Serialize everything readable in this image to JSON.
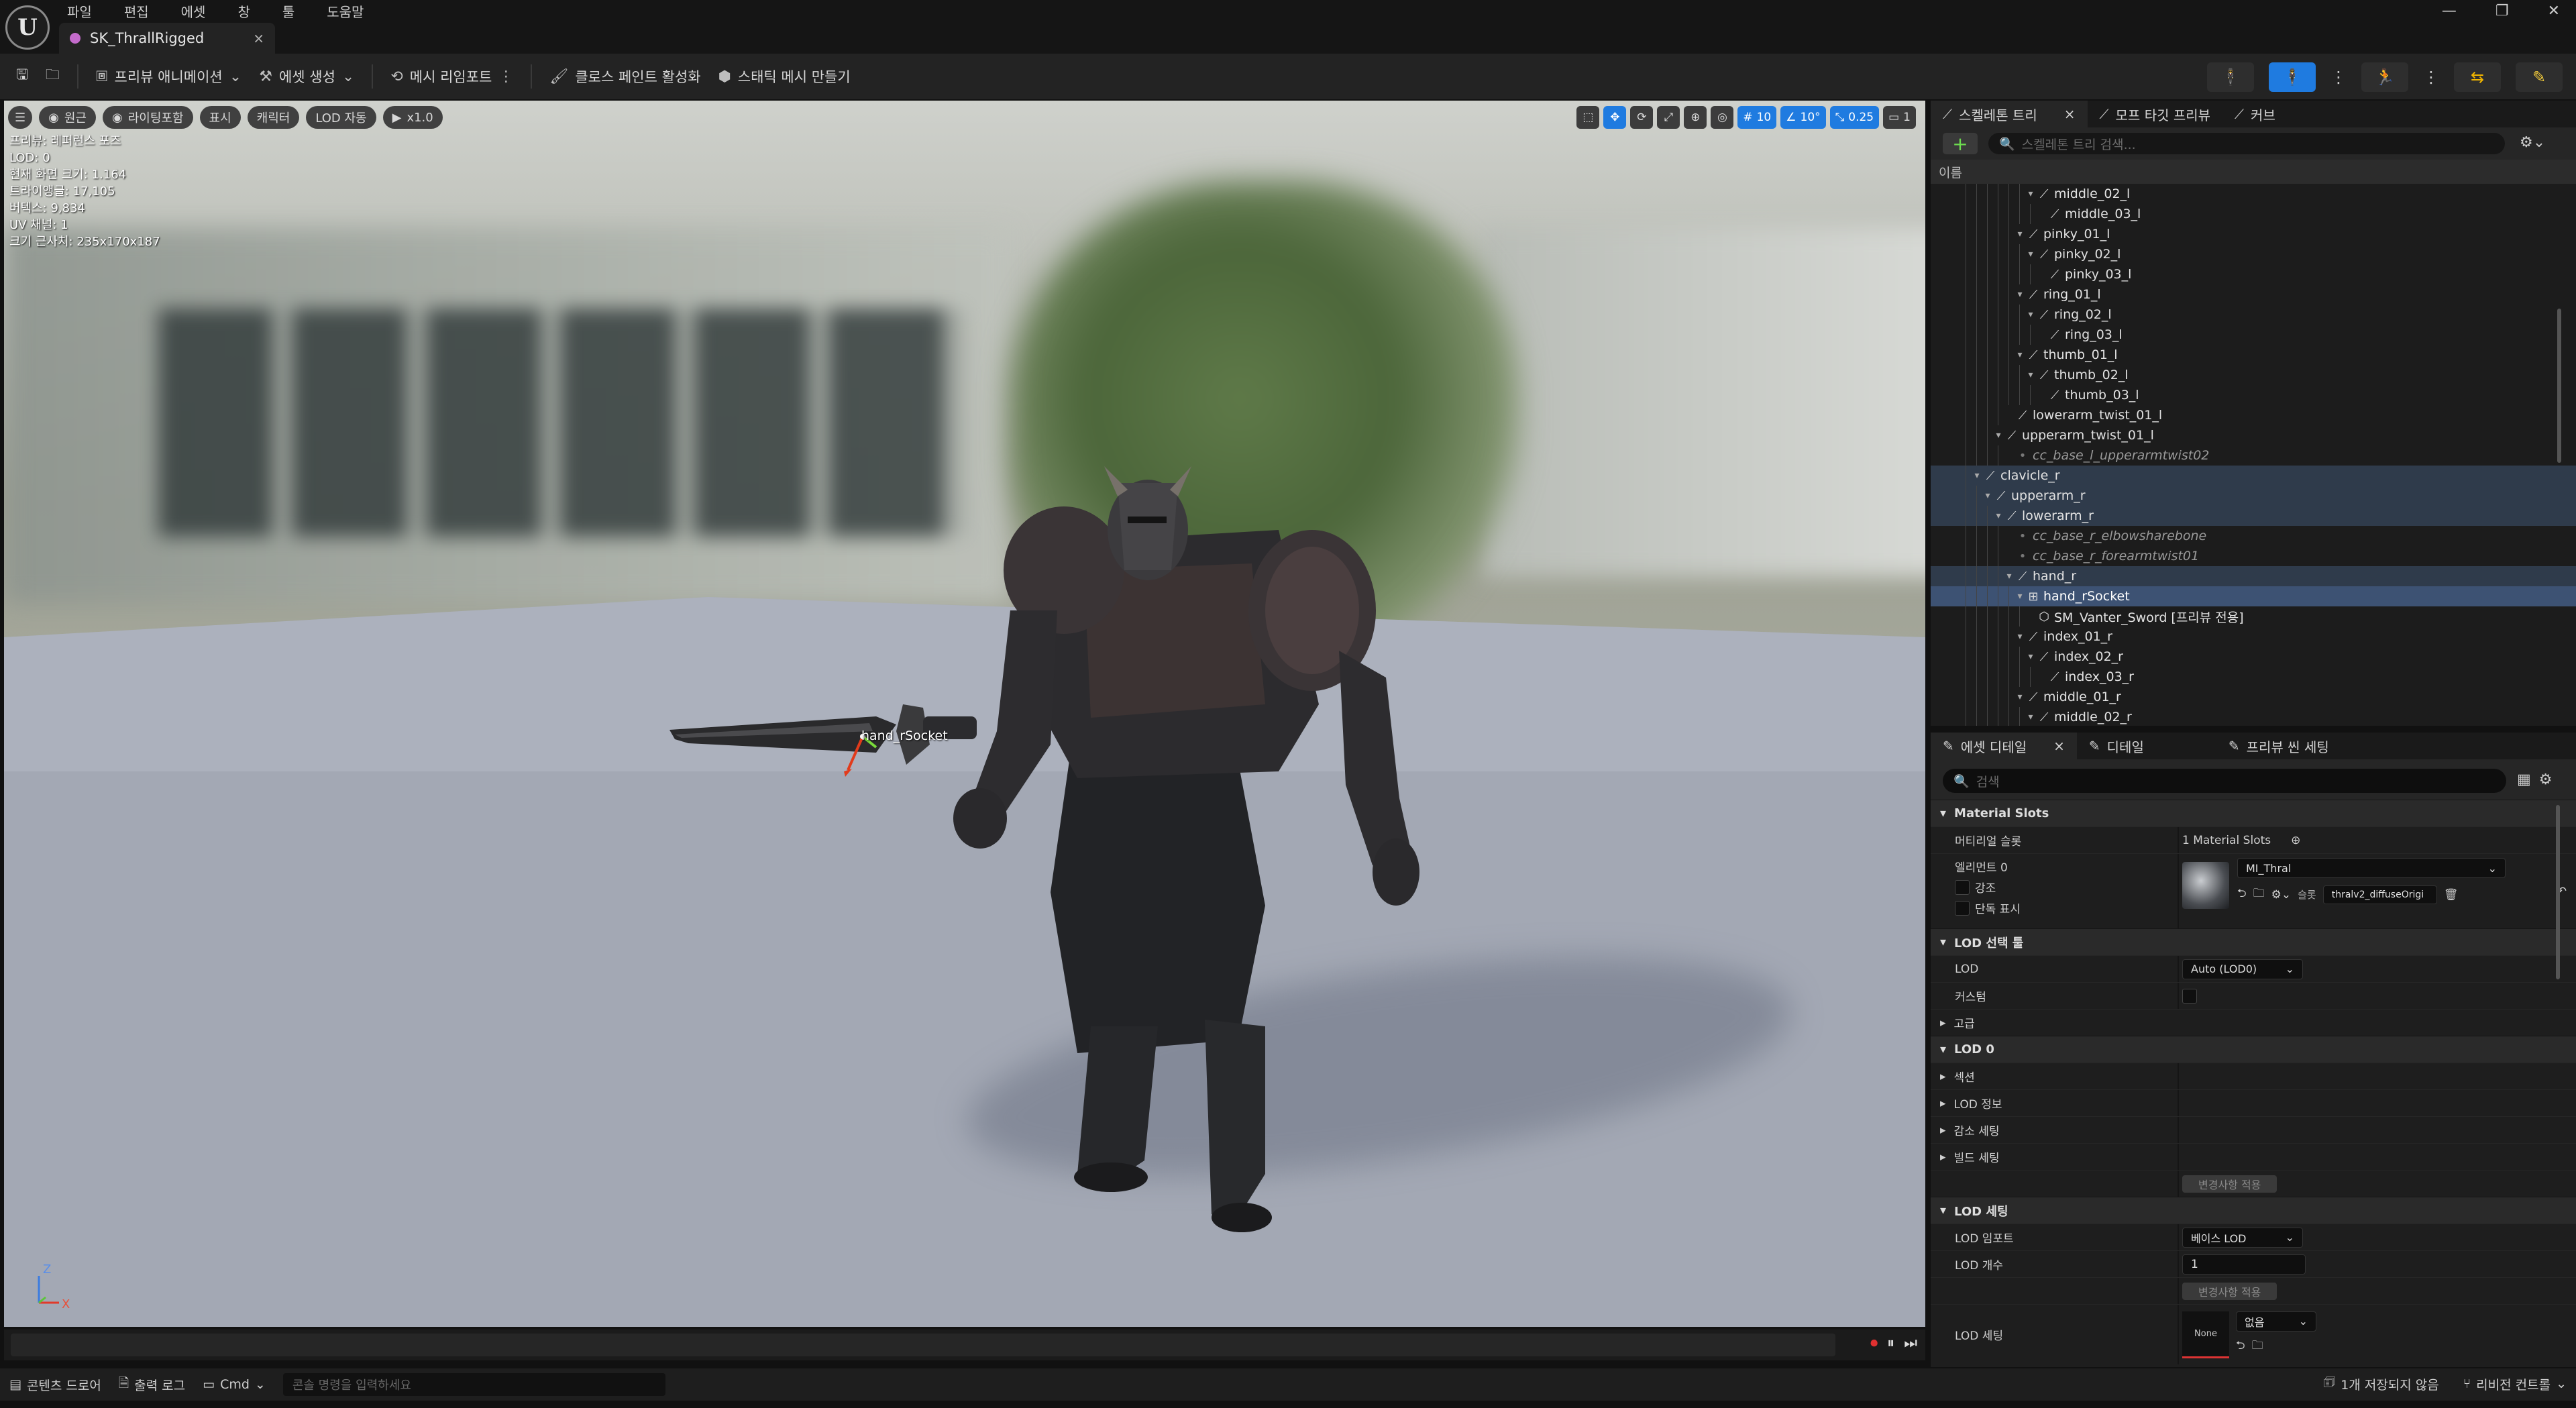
{
  "app": {
    "logo": "U",
    "tab_title": "SK_ThrallRigged",
    "tab_close": "×"
  },
  "menu": [
    "파일",
    "편집",
    "에셋",
    "창",
    "툴",
    "도움말"
  ],
  "window_controls": [
    "—",
    "❐",
    "✕"
  ],
  "toolbar": {
    "save_icon": "save-icon",
    "browse_icon": "browse-icon",
    "preview_animation": "프리뷰 애니메이션",
    "create_asset": "에셋 생성",
    "reimport_mesh": "메시 리임포트",
    "cloth_paint": "클로스 페인트 활성화",
    "make_static_mesh": "스태틱 메시 만들기"
  },
  "viewport": {
    "top_left": [
      "원근",
      "라이팅포함",
      "표시",
      "캐릭터",
      "LOD 자동",
      "x1.0"
    ],
    "top_right": {
      "grid": "10",
      "angle": "10°",
      "scale": "0.25",
      "camera": "1"
    },
    "stats": [
      "프리뷰: 레퍼런스 포즈",
      "LOD: 0",
      "현재 화면 크기: 1.164",
      "트라이앵글: 17,105",
      "버텍스: 9,834",
      "UV 채널: 1",
      "크기 근사치: 235x170x187"
    ],
    "socket_label": "hand_rSocket",
    "axes": {
      "z": "Z",
      "x": "X"
    }
  },
  "statusbar": {
    "content_drawer": "콘텐츠 드로어",
    "output_log": "출력 로그",
    "cmd": "Cmd",
    "cmd_placeholder": "콘솔 명령을 입력하세요",
    "unsaved": "1개 저장되지 않음",
    "revision_control": "리비전 컨트롤"
  },
  "skeleton_panel": {
    "tabs": [
      "스켈레톤 트리",
      "모프 타깃 프리뷰",
      "커브"
    ],
    "search_placeholder": "스켈레톤 트리 검색...",
    "column": "이름",
    "rows": [
      {
        "label": "middle_02_l",
        "depth": 5,
        "tw": "▾",
        "kind": "bone"
      },
      {
        "label": "middle_03_l",
        "depth": 6,
        "tw": "",
        "kind": "bone"
      },
      {
        "label": "pinky_01_l",
        "depth": 4,
        "tw": "▾",
        "kind": "bone"
      },
      {
        "label": "pinky_02_l",
        "depth": 5,
        "tw": "▾",
        "kind": "bone"
      },
      {
        "label": "pinky_03_l",
        "depth": 6,
        "tw": "",
        "kind": "bone"
      },
      {
        "label": "ring_01_l",
        "depth": 4,
        "tw": "▾",
        "kind": "bone"
      },
      {
        "label": "ring_02_l",
        "depth": 5,
        "tw": "▾",
        "kind": "bone"
      },
      {
        "label": "ring_03_l",
        "depth": 6,
        "tw": "",
        "kind": "bone"
      },
      {
        "label": "thumb_01_l",
        "depth": 4,
        "tw": "▾",
        "kind": "bone"
      },
      {
        "label": "thumb_02_l",
        "depth": 5,
        "tw": "▾",
        "kind": "bone"
      },
      {
        "label": "thumb_03_l",
        "depth": 6,
        "tw": "",
        "kind": "bone"
      },
      {
        "label": "lowerarm_twist_01_l",
        "depth": 3,
        "tw": "",
        "kind": "bone"
      },
      {
        "label": "upperarm_twist_01_l",
        "depth": 2,
        "tw": "▾",
        "kind": "bone"
      },
      {
        "label": "cc_base_l_upperarmtwist02",
        "depth": 3,
        "tw": "",
        "kind": "soft"
      },
      {
        "label": "clavicle_r",
        "depth": 0,
        "tw": "▾",
        "kind": "hl"
      },
      {
        "label": "upperarm_r",
        "depth": 1,
        "tw": "▾",
        "kind": "hl"
      },
      {
        "label": "lowerarm_r",
        "depth": 2,
        "tw": "▾",
        "kind": "hl"
      },
      {
        "label": "cc_base_r_elbowsharebone",
        "depth": 3,
        "tw": "",
        "kind": "soft"
      },
      {
        "label": "cc_base_r_forearmtwist01",
        "depth": 3,
        "tw": "",
        "kind": "soft"
      },
      {
        "label": "hand_r",
        "depth": 3,
        "tw": "▾",
        "kind": "hl"
      },
      {
        "label": "hand_rSocket",
        "depth": 4,
        "tw": "▾",
        "kind": "sel"
      },
      {
        "label": "SM_Vanter_Sword [프리뷰 전용]",
        "depth": 5,
        "tw": "",
        "kind": "mesh"
      },
      {
        "label": "index_01_r",
        "depth": 4,
        "tw": "▾",
        "kind": "bone"
      },
      {
        "label": "index_02_r",
        "depth": 5,
        "tw": "▾",
        "kind": "bone"
      },
      {
        "label": "index_03_r",
        "depth": 6,
        "tw": "",
        "kind": "bone"
      },
      {
        "label": "middle_01_r",
        "depth": 4,
        "tw": "▾",
        "kind": "bone"
      },
      {
        "label": "middle_02_r",
        "depth": 5,
        "tw": "▾",
        "kind": "bone"
      }
    ]
  },
  "details_panel": {
    "tabs": [
      "에셋 디테일",
      "디테일",
      "프리뷰 씬 세팅"
    ],
    "search_placeholder": "검색",
    "material_slots": {
      "section": "Material Slots",
      "label": "머티리얼 슬롯",
      "count": "1 Material Slots",
      "element": "엘리먼트 0",
      "highlight": "강조",
      "isolate": "단독 표시",
      "material": "MI_Thral",
      "slot_label": "슬롯",
      "slot_name": "thralv2_diffuseOrigi"
    },
    "lod_picker": {
      "section": "LOD 선택 툴",
      "lod_label": "LOD",
      "lod_value": "Auto (LOD0)",
      "custom_label": "커스텀",
      "advanced": "고급"
    },
    "lod0": {
      "section": "LOD 0",
      "items": [
        "섹션",
        "LOD 정보",
        "감소 세팅",
        "빌드 세팅"
      ],
      "apply": "변경사항 적용"
    },
    "lod_settings": {
      "section": "LOD 세팅",
      "import_label": "LOD 임포트",
      "import_value": "베이스 LOD",
      "count_label": "LOD 개수",
      "count_value": "1",
      "apply": "변경사항 적용",
      "settings_label": "LOD 세팅",
      "settings_thumb": "None",
      "settings_value": "없음"
    }
  }
}
